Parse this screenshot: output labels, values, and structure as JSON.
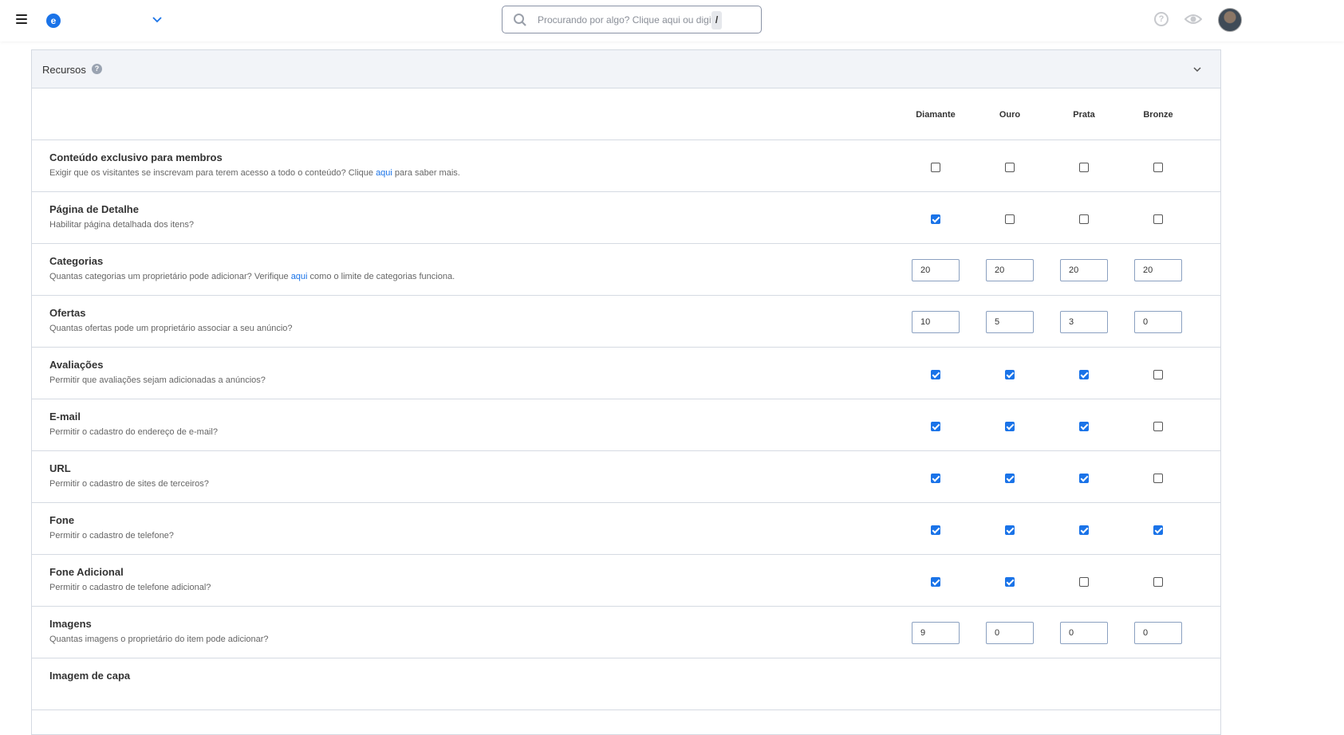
{
  "header": {
    "logo_letter": "e",
    "search_placeholder": "Procurando por algo? Clique aqui ou digite",
    "search_shortcut": "/"
  },
  "panel": {
    "title": "Recursos",
    "help_glyph": "?"
  },
  "columns": [
    "Diamante",
    "Ouro",
    "Prata",
    "Bronze"
  ],
  "rows": [
    {
      "title": "Conteúdo exclusivo para membros",
      "desc_before": "Exigir que os visitantes se inscrevam para terem acesso a todo o conteúdo? Clique ",
      "desc_link": "aqui",
      "desc_after": " para saber mais.",
      "kind": "checkbox",
      "values": [
        false,
        false,
        false,
        false
      ]
    },
    {
      "title": "Página de Detalhe",
      "desc_before": "Habilitar página detalhada dos itens?",
      "desc_link": "",
      "desc_after": "",
      "kind": "checkbox",
      "values": [
        true,
        false,
        false,
        false
      ]
    },
    {
      "title": "Categorias",
      "desc_before": "Quantas categorias um proprietário pode adicionar? Verifique ",
      "desc_link": "aqui",
      "desc_after": " como o limite de categorias funciona.",
      "kind": "number",
      "values": [
        "20",
        "20",
        "20",
        "20"
      ]
    },
    {
      "title": "Ofertas",
      "desc_before": "Quantas ofertas pode um proprietário associar a seu anúncio?",
      "desc_link": "",
      "desc_after": "",
      "kind": "number",
      "values": [
        "10",
        "5",
        "3",
        "0"
      ]
    },
    {
      "title": "Avaliações",
      "desc_before": "Permitir que avaliações sejam adicionadas a anúncios?",
      "desc_link": "",
      "desc_after": "",
      "kind": "checkbox",
      "values": [
        true,
        true,
        true,
        false
      ]
    },
    {
      "title": "E-mail",
      "desc_before": "Permitir o cadastro do endereço de e-mail?",
      "desc_link": "",
      "desc_after": "",
      "kind": "checkbox",
      "values": [
        true,
        true,
        true,
        false
      ]
    },
    {
      "title": "URL",
      "desc_before": "Permitir o cadastro de sites de terceiros?",
      "desc_link": "",
      "desc_after": "",
      "kind": "checkbox",
      "values": [
        true,
        true,
        true,
        false
      ]
    },
    {
      "title": "Fone",
      "desc_before": "Permitir o cadastro de telefone?",
      "desc_link": "",
      "desc_after": "",
      "kind": "checkbox",
      "values": [
        true,
        true,
        true,
        true
      ]
    },
    {
      "title": "Fone Adicional",
      "desc_before": "Permitir o cadastro de telefone adicional?",
      "desc_link": "",
      "desc_after": "",
      "kind": "checkbox",
      "values": [
        true,
        true,
        false,
        false
      ]
    },
    {
      "title": "Imagens",
      "desc_before": "Quantas imagens o proprietário do item pode adicionar?",
      "desc_link": "",
      "desc_after": "",
      "kind": "number",
      "values": [
        "9",
        "0",
        "0",
        "0"
      ]
    },
    {
      "title": "Imagem de capa",
      "desc_before": "",
      "desc_link": "",
      "desc_after": "",
      "kind": "none",
      "values": []
    }
  ],
  "colors": {
    "accent": "#1a73e8",
    "border": "#d5dae2",
    "header_bg": "#f2f4f8"
  }
}
